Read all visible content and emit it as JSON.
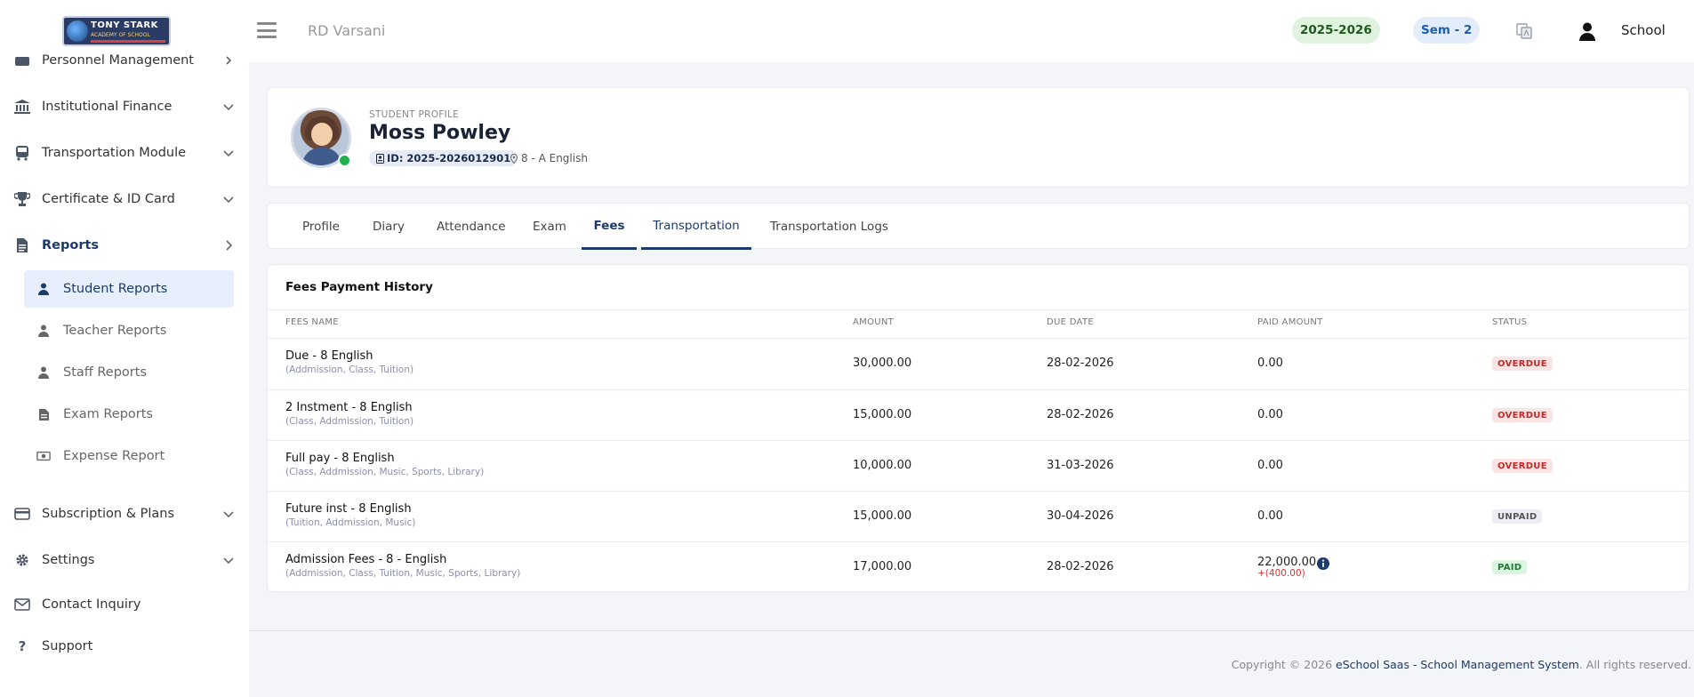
{
  "logo": {
    "top": "TONY STARK",
    "middle": "ACADEMY OF SCHOOL"
  },
  "sidebar": {
    "items": [
      {
        "label": "Personnel Management",
        "icon": "users-icon"
      },
      {
        "label": "Institutional Finance",
        "icon": "bank-icon"
      },
      {
        "label": "Transportation Module",
        "icon": "bus-icon"
      },
      {
        "label": "Certificate & ID Card",
        "icon": "trophy-icon"
      },
      {
        "label": "Reports",
        "icon": "file-icon"
      },
      {
        "label": "Subscription & Plans",
        "icon": "credit-card-icon"
      },
      {
        "label": "Settings",
        "icon": "gear-icon"
      },
      {
        "label": "Contact Inquiry",
        "icon": "envelope-icon"
      },
      {
        "label": "Support",
        "icon": "question-icon"
      }
    ],
    "reports_sub": [
      {
        "label": "Student Reports",
        "icon": "user-icon"
      },
      {
        "label": "Teacher Reports",
        "icon": "user-icon"
      },
      {
        "label": "Staff Reports",
        "icon": "user-icon"
      },
      {
        "label": "Exam Reports",
        "icon": "file-icon"
      },
      {
        "label": "Expense Report",
        "icon": "money-icon"
      }
    ]
  },
  "header": {
    "school_name": "RD Varsani",
    "session": "2025-2026",
    "semester": "Sem - 2",
    "user": "School"
  },
  "profile": {
    "caption": "STUDENT PROFILE",
    "name": "Moss Powley",
    "id": "ID: 2025-2026012901",
    "class": "8 - A English"
  },
  "tabs": [
    "Profile",
    "Diary",
    "Attendance",
    "Exam",
    "Fees",
    "Transportation",
    "Transportation Logs"
  ],
  "fees": {
    "title": "Fees Payment History",
    "columns": [
      "FEES NAME",
      "AMOUNT",
      "DUE DATE",
      "PAID AMOUNT",
      "STATUS"
    ],
    "rows": [
      {
        "name": "Due - 8 English",
        "sub": "(Addmission, Class, Tuition)",
        "amount": "30,000.00",
        "due": "28-02-2026",
        "paid": "0.00",
        "extra": "",
        "status": "OVERDUE"
      },
      {
        "name": "2 Instment - 8 English",
        "sub": "(Class, Addmission, Tuition)",
        "amount": "15,000.00",
        "due": "28-02-2026",
        "paid": "0.00",
        "extra": "",
        "status": "OVERDUE"
      },
      {
        "name": "Full pay - 8 English",
        "sub": "(Class, Addmission, Music, Sports, Library)",
        "amount": "10,000.00",
        "due": "31-03-2026",
        "paid": "0.00",
        "extra": "",
        "status": "OVERDUE"
      },
      {
        "name": "Future inst - 8 English",
        "sub": "(Tuition, Addmission, Music)",
        "amount": "15,000.00",
        "due": "30-04-2026",
        "paid": "0.00",
        "extra": "",
        "status": "UNPAID"
      },
      {
        "name": "Admission Fees - 8 - English",
        "sub": "(Addmission, Class, Tuition, Music, Sports, Library)",
        "amount": "17,000.00",
        "due": "28-02-2026",
        "paid": "22,000.00",
        "extra": "+(400.00)",
        "status": "PAID"
      }
    ]
  },
  "footer": {
    "prefix": "Copyright © 2026 ",
    "link": "eSchool Saas - School Management System",
    "suffix": ". All rights reserved."
  },
  "colors": {
    "accent": "#1b3b6b",
    "overdue": "#c62828",
    "paid": "#1f7a32"
  }
}
